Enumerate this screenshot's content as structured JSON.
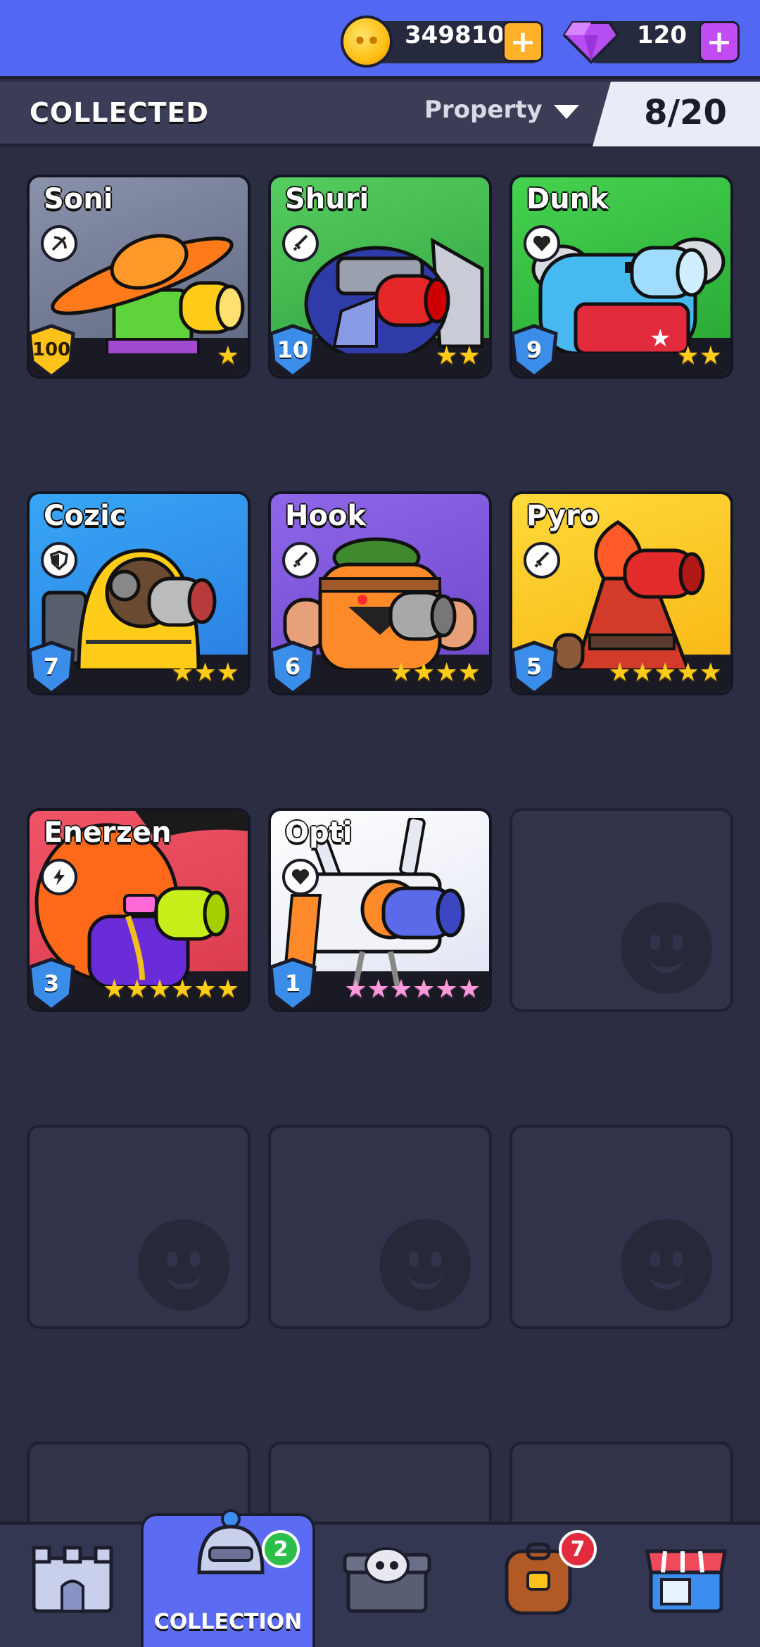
{
  "currency": {
    "coins": "349810",
    "gems": "120"
  },
  "header": {
    "title": "COLLECTED",
    "sort_label": "Property",
    "collected_count": "8/20"
  },
  "cards": [
    {
      "name": "Soni",
      "level": "100",
      "stars": 1,
      "class_icon": "bow-icon",
      "bg": "#7a8199"
    },
    {
      "name": "Shuri",
      "level": "10",
      "stars": 2,
      "class_icon": "sword-icon",
      "bg": "#3fb54b"
    },
    {
      "name": "Dunk",
      "level": "9",
      "stars": 2,
      "class_icon": "heart-icon",
      "bg": "#33c23f"
    },
    {
      "name": "Cozic",
      "level": "7",
      "stars": 3,
      "class_icon": "shield-icon",
      "bg": "#2f95ef"
    },
    {
      "name": "Hook",
      "level": "6",
      "stars": 4,
      "class_icon": "sword-icon",
      "bg": "#7d55d9"
    },
    {
      "name": "Pyro",
      "level": "5",
      "stars": 5,
      "class_icon": "sword-icon",
      "bg": "#ffcc1d"
    },
    {
      "name": "Enerzen",
      "level": "3",
      "stars": 6,
      "class_icon": "lightning-icon",
      "bg": "#e94b5a"
    },
    {
      "name": "Opti",
      "level": "1",
      "stars": 6,
      "rainbow": true,
      "class_icon": "heart-icon",
      "bg": "#eef0f8"
    }
  ],
  "nav": {
    "active_label": "COLLECTION",
    "collection_badge": "2",
    "backpack_badge": "7",
    "items": [
      "castle-icon",
      "collection-helmet-icon",
      "skull-chest-icon",
      "backpack-icon",
      "shop-icon"
    ]
  }
}
